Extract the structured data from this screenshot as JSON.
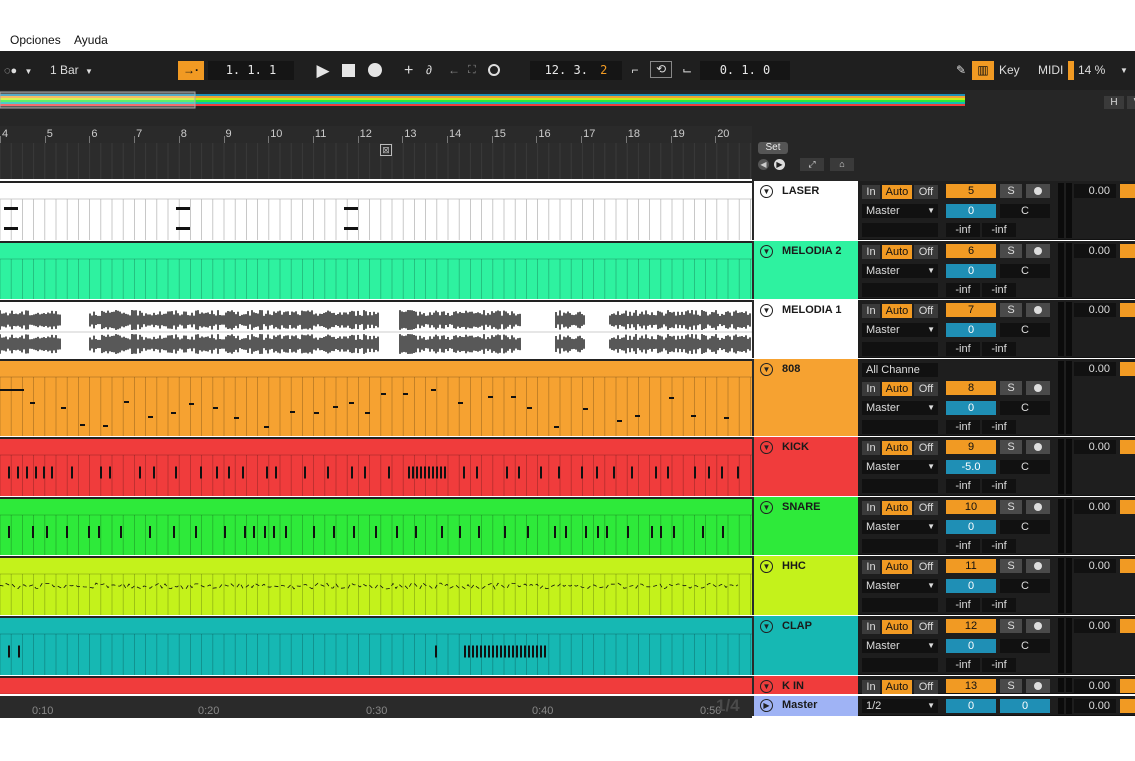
{
  "menu": [
    "Opciones",
    "Ayuda"
  ],
  "controlbar": {
    "quantize": "1 Bar",
    "arrangement_position": "1.  1.  1",
    "song_position": "12.  3.",
    "song_position_sixteenth": "2",
    "loop_length": "0.  1.  0",
    "key_label": "Key",
    "midi_label": "MIDI",
    "cpu": "14 %"
  },
  "ruler": {
    "bars": [
      "4",
      "5",
      "6",
      "7",
      "8",
      "9",
      "10",
      "11",
      "12",
      "13",
      "14",
      "15",
      "16",
      "17",
      "18",
      "19",
      "20"
    ],
    "set_label": "Set",
    "times": [
      "0:10",
      "0:20",
      "0:30",
      "0:40",
      "0:50"
    ],
    "page_indicator": "1/4"
  },
  "overview_buttons": [
    "H",
    "V"
  ],
  "tracks": [
    {
      "name": "LASER",
      "input": "",
      "output": "Master",
      "number": "5",
      "pan": "C",
      "vol": "0",
      "send1": "-inf",
      "send2": "-inf",
      "meter_value": "0.00",
      "color": "#ffffff",
      "header_color": "#ffffff",
      "kind": "midi"
    },
    {
      "name": "MELODIA 2",
      "input": "",
      "output": "Master",
      "number": "6",
      "pan": "C",
      "vol": "0",
      "send1": "-inf",
      "send2": "-inf",
      "meter_value": "0.00",
      "color": "#2ef2a0",
      "header_color": "#2ef2a0",
      "kind": "grid"
    },
    {
      "name": "MELODIA 1",
      "input": "",
      "output": "Master",
      "number": "7",
      "pan": "C",
      "vol": "0",
      "send1": "-inf",
      "send2": "-inf",
      "meter_value": "0.00",
      "color": "#ffffff",
      "header_color": "#ffffff",
      "kind": "audio"
    },
    {
      "name": "808",
      "input": "All Channe",
      "output": "Master",
      "number": "8",
      "pan": "C",
      "vol": "0",
      "send1": "-inf",
      "send2": "-inf",
      "meter_value": "0.00",
      "color": "#f6a231",
      "header_color": "#f6a231",
      "kind": "midi"
    },
    {
      "name": "KICK",
      "input": "",
      "output": "Master",
      "number": "9",
      "pan": "C",
      "vol": "-5.0",
      "send1": "-inf",
      "send2": "-inf",
      "meter_value": "0.00",
      "color": "#f03c3c",
      "header_color": "#f03c3c",
      "kind": "drum"
    },
    {
      "name": "SNARE",
      "input": "",
      "output": "Master",
      "number": "10",
      "pan": "C",
      "vol": "0",
      "send1": "-inf",
      "send2": "-inf",
      "meter_value": "0.00",
      "color": "#2eea3a",
      "header_color": "#2eea3a",
      "kind": "drum"
    },
    {
      "name": "HHC",
      "input": "",
      "output": "Master",
      "number": "11",
      "pan": "C",
      "vol": "0",
      "send1": "-inf",
      "send2": "-inf",
      "meter_value": "0.00",
      "color": "#c4f21b",
      "header_color": "#c4f21b",
      "kind": "hhc"
    },
    {
      "name": "CLAP",
      "input": "",
      "output": "Master",
      "number": "12",
      "pan": "C",
      "vol": "0",
      "send1": "-inf",
      "send2": "-inf",
      "meter_value": "0.00",
      "color": "#16b8b3",
      "header_color": "#16b8b3",
      "kind": "drum"
    },
    {
      "name": "K IN",
      "input": "",
      "output": "",
      "number": "13",
      "pan": "",
      "vol": "",
      "send1": "",
      "send2": "",
      "meter_value": "0.00",
      "color": "#f03c3c",
      "header_color": "#f03c3c",
      "kind": "collapsed"
    }
  ],
  "master": {
    "name": "Master",
    "output": "1/2",
    "vol": "0",
    "pan": "0",
    "meter_value": "0.00",
    "color": "#9fb3f5"
  },
  "labels": {
    "in": "In",
    "auto": "Auto",
    "off": "Off",
    "solo": "S"
  }
}
